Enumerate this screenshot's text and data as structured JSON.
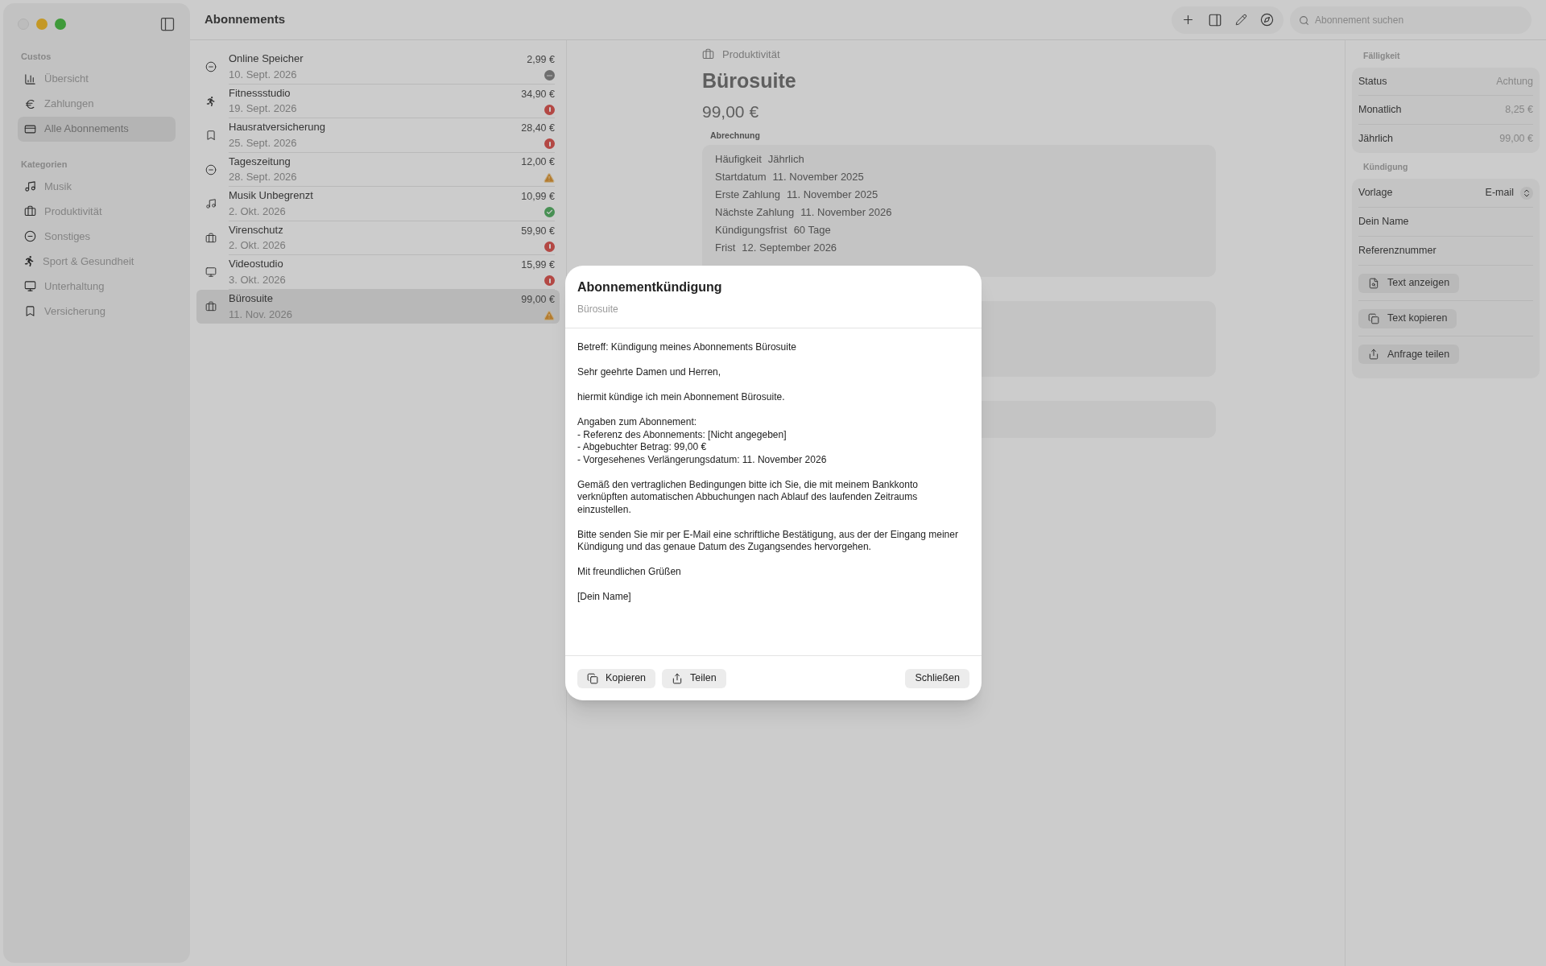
{
  "window": {
    "title": "Abonnements"
  },
  "sidebar": {
    "sections": [
      {
        "title": "Custos",
        "items": [
          {
            "label": "Übersicht",
            "icon": {
              "kind": "chart"
            },
            "selected": false
          },
          {
            "label": "Zahlungen",
            "icon": {
              "kind": "euro"
            },
            "selected": false
          },
          {
            "label": "Alle Abonnements",
            "icon": {
              "kind": "card"
            },
            "selected": true
          }
        ]
      },
      {
        "title": "Kategorien",
        "items": [
          {
            "label": "Musik",
            "icon": {
              "kind": "music"
            },
            "selected": false
          },
          {
            "label": "Produktivität",
            "icon": {
              "kind": "briefcase"
            },
            "selected": false
          },
          {
            "label": "Sonstiges",
            "icon": {
              "kind": "minus"
            },
            "selected": false
          },
          {
            "label": "Sport & Gesundheit",
            "icon": {
              "kind": "run"
            },
            "selected": false
          },
          {
            "label": "Unterhaltung",
            "icon": {
              "kind": "monitor"
            },
            "selected": false
          },
          {
            "label": "Versicherung",
            "icon": {
              "kind": "bookmark"
            },
            "selected": false
          }
        ]
      }
    ]
  },
  "toolbar": {
    "search": {
      "placeholder": "Abonnement suchen"
    }
  },
  "subscriptions": [
    {
      "name": "Online Speicher",
      "date": "10. Sept. 2026",
      "price": "2,99 €",
      "icon": {
        "kind": "minus"
      },
      "status": {
        "kind": "paused"
      },
      "selected": false
    },
    {
      "name": "Fitnessstudio",
      "date": "19. Sept. 2026",
      "price": "34,90 €",
      "icon": {
        "kind": "run"
      },
      "status": {
        "kind": "overdue"
      },
      "selected": false
    },
    {
      "name": "Hausratversicherung",
      "date": "25. Sept. 2026",
      "price": "28,40 €",
      "icon": {
        "kind": "bookmark"
      },
      "status": {
        "kind": "overdue"
      },
      "selected": false
    },
    {
      "name": "Tageszeitung",
      "date": "28. Sept. 2026",
      "price": "12,00 €",
      "icon": {
        "kind": "minus"
      },
      "status": {
        "kind": "warning"
      },
      "selected": false
    },
    {
      "name": "Musik Unbegrenzt",
      "date": "2. Okt. 2026",
      "price": "10,99 €",
      "icon": {
        "kind": "music"
      },
      "status": {
        "kind": "ok"
      },
      "selected": false
    },
    {
      "name": "Virenschutz",
      "date": "2. Okt. 2026",
      "price": "59,90 €",
      "icon": {
        "kind": "briefcase"
      },
      "status": {
        "kind": "overdue"
      },
      "selected": false
    },
    {
      "name": "Videostudio",
      "date": "3. Okt. 2026",
      "price": "15,99 €",
      "icon": {
        "kind": "monitor"
      },
      "status": {
        "kind": "overdue"
      },
      "selected": false
    },
    {
      "name": "Bürosuite",
      "date": "11. Nov. 2026",
      "price": "99,00 €",
      "icon": {
        "kind": "briefcase"
      },
      "status": {
        "kind": "warning"
      },
      "selected": true
    }
  ],
  "detail": {
    "category": "Produktivität",
    "name": "Bürosuite",
    "price": "99,00 €",
    "billing_title": "Abrechnung",
    "billing": [
      {
        "label": "Häufigkeit",
        "value": "Jährlich"
      },
      {
        "label": "Startdatum",
        "value": "11. November 2025"
      },
      {
        "label": "Erste Zahlung",
        "value": "11. November 2025"
      },
      {
        "label": "Nächste Zahlung",
        "value": "11. November 2026"
      },
      {
        "label": "Kündigungsfrist",
        "value": "60 Tage"
      },
      {
        "label": "Frist",
        "value": "12. September 2026"
      }
    ]
  },
  "inspector": {
    "due_title": "Fälligkeit",
    "due": [
      {
        "label": "Status",
        "value": "Achtung"
      },
      {
        "label": "Monatlich",
        "value": "8,25 €"
      },
      {
        "label": "Jährlich",
        "value": "99,00 €"
      }
    ],
    "cancel_title": "Kündigung",
    "template": {
      "label": "Vorlage",
      "value": "E-mail"
    },
    "fields": [
      {
        "placeholder": "Dein Name"
      },
      {
        "placeholder": "Referenznummer"
      }
    ],
    "actions": [
      {
        "label": "Text anzeigen",
        "icon": {
          "kind": "doc"
        }
      },
      {
        "label": "Text kopieren",
        "icon": {
          "kind": "copy"
        }
      },
      {
        "label": "Anfrage teilen",
        "icon": {
          "kind": "share"
        }
      }
    ]
  },
  "dialog": {
    "title": "Abonnementkündigung",
    "subtitle": "Bürosuite",
    "paragraphs": [
      "Betreff: Kündigung meines Abonnements Bürosuite",
      "Sehr geehrte Damen und Herren,",
      "hiermit kündige ich mein Abonnement Bürosuite.",
      "Angaben zum Abonnement:\n- Referenz des Abonnements: [Nicht angegeben]\n- Abgebuchter Betrag: 99,00 €\n- Vorgesehenes Verlängerungsdatum: 11. November 2026",
      "Gemäß den vertraglichen Bedingungen bitte ich Sie, die mit meinem Bankkonto verknüpften automatischen Abbuchungen nach Ablauf des laufenden Zeitraums einzustellen.",
      "Bitte senden Sie mir per E-Mail eine schriftliche Bestätigung, aus der der Eingang meiner Kündigung und das genaue Datum des Zugangsendes hervorgehen.",
      "Mit freundlichen Grüßen",
      "[Dein Name]"
    ],
    "buttons": [
      {
        "label": "Kopieren",
        "icon": {
          "kind": "copy"
        }
      },
      {
        "label": "Teilen",
        "icon": {
          "kind": "share"
        }
      }
    ],
    "close": "Schließen"
  }
}
